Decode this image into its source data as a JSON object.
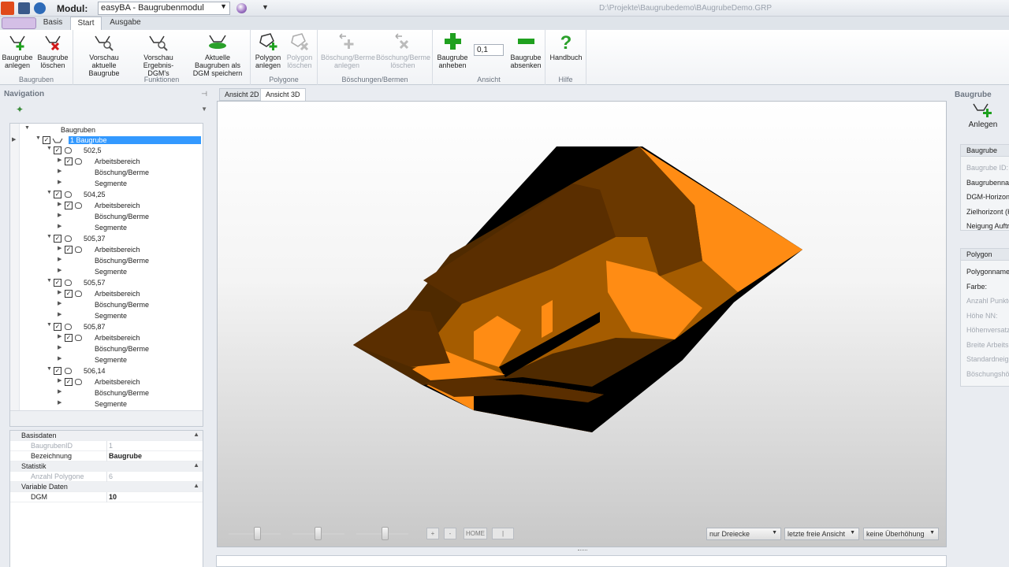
{
  "titlebar": {
    "modul_label": "Modul:",
    "modul_value": "easyBA  - Baugrubenmodul",
    "file_path": "D:\\Projekte\\Baugrubedemo\\BAugrubeDemo.GRP"
  },
  "ribbon_tabs": [
    "Basis",
    "Start",
    "Ausgabe"
  ],
  "ribbon": {
    "groups": [
      {
        "title": "Baugruben",
        "buttons": [
          {
            "label": "Baugrube anlegen",
            "icon": "baugrube-add-icon"
          },
          {
            "label": "Baugrube löschen",
            "icon": "baugrube-delete-icon"
          }
        ]
      },
      {
        "title": "Funktionen",
        "buttons": [
          {
            "label": "Vorschau aktuelle Baugrube",
            "icon": "preview-icon"
          },
          {
            "label": "Vorschau Ergebnis-DGM's",
            "icon": "preview-dgm-icon"
          },
          {
            "label": "Aktuelle Baugruben als DGM speichern",
            "icon": "save-dgm-icon"
          }
        ]
      },
      {
        "title": "Polygone",
        "buttons": [
          {
            "label": "Polygon anlegen",
            "icon": "polygon-add-icon"
          },
          {
            "label": "Polygon löschen",
            "icon": "polygon-delete-icon"
          }
        ]
      },
      {
        "title": "Böschungen/Bermen",
        "buttons": [
          {
            "label": "Böschung/Berme anlegen",
            "icon": "berme-add-icon"
          },
          {
            "label": "Böschung/Berme löschen",
            "icon": "berme-delete-icon"
          }
        ]
      },
      {
        "title": "Ansicht",
        "buttons": [
          {
            "label": "Baugrube anheben",
            "icon": "plus-icon"
          },
          {
            "label": "Baugrube absenken",
            "icon": "minus-icon"
          }
        ],
        "step_value": "0,1"
      },
      {
        "title": "Hilfe",
        "buttons": [
          {
            "label": "Handbuch",
            "icon": "help-icon"
          }
        ]
      }
    ]
  },
  "navigation": {
    "title": "Navigation",
    "tree_root": "Baugruben",
    "selected": "1 Baugrube",
    "horizons": [
      {
        "label": "502,5",
        "children": [
          "Arbeitsbereich",
          "Böschung/Berme",
          "Segmente"
        ]
      },
      {
        "label": "504,25",
        "children": [
          "Arbeitsbereich",
          "Böschung/Berme",
          "Segmente"
        ]
      },
      {
        "label": "505,37",
        "children": [
          "Arbeitsbereich",
          "Böschung/Berme",
          "Segmente"
        ]
      },
      {
        "label": "505,57",
        "children": [
          "Arbeitsbereich",
          "Böschung/Berme",
          "Segmente"
        ]
      },
      {
        "label": "505,87",
        "children": [
          "Arbeitsbereich",
          "Böschung/Berme",
          "Segmente"
        ]
      },
      {
        "label": "506,14",
        "children": [
          "Arbeitsbereich",
          "Böschung/Berme",
          "Segmente"
        ]
      }
    ]
  },
  "properties": {
    "cat_basis": "Basisdaten",
    "baugruben_id_key": "BaugrubenID",
    "baugruben_id_val": "1",
    "bezeichnung_key": "Bezeichnung",
    "bezeichnung_val": "Baugrube",
    "cat_statistik": "Statistik",
    "anzahl_key": "Anzahl Polygone",
    "anzahl_val": "6",
    "cat_variable": "Variable Daten",
    "dgm_key": "DGM",
    "dgm_val": "10"
  },
  "view_tabs": [
    "Ansicht 2D",
    "Ansicht 3D"
  ],
  "view_controls": {
    "btn_plus": "+",
    "btn_minus": "-",
    "btn_home": "HOME",
    "btn_bar": "|",
    "dd_render": "nur Dreiecke",
    "dd_view": "letzte freie Ansicht",
    "dd_exag": "keine Überhöhung"
  },
  "right_panel": {
    "title": "Baugrube",
    "anlegen": "Anlegen",
    "box_baugrube": "Baugrube",
    "fields_baugrube": [
      "Baugrube ID:",
      "Baugrubenname:",
      "DGM-Horizont:",
      "Zielhorizont (KZ):",
      "Neigung Auftrag:"
    ],
    "box_polygon": "Polygon",
    "fields_polygon": [
      "Polygonname:",
      "Farbe:",
      "Anzahl Punkte:",
      "Höhe NN:",
      "Höhenversatz:",
      "Breite Arbeitsb.:",
      "Standardneigung:",
      "Böschungshöhe:"
    ]
  },
  "colors": {
    "orange": "#ff8c14",
    "brown_dark": "#5a3000",
    "accent_blue": "#3399ff"
  }
}
